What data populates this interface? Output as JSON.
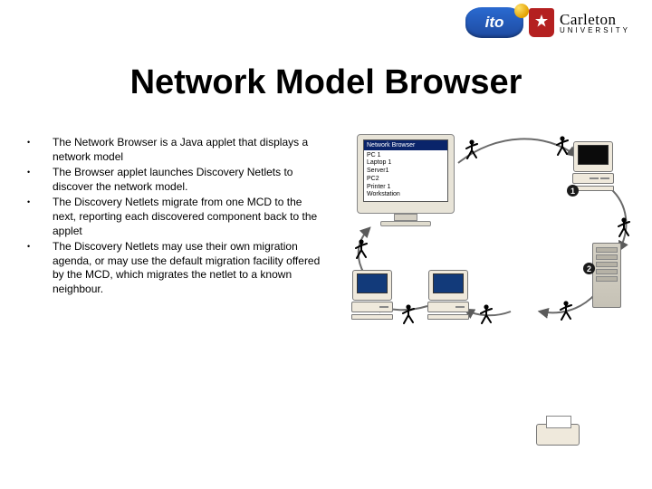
{
  "header": {
    "logo_ito_text": "ito",
    "carleton_name": "Carleton",
    "carleton_sub": "UNIVERSITY"
  },
  "title": "Network Model Browser",
  "bullets": [
    "The Network Browser is a Java applet that displays a network model",
    "The Browser applet launches Discovery Netlets to discover the network model.",
    "The Discovery Netlets migrate from one MCD to the next, reporting each discovered component back to the applet",
    "The Discovery Netlets may use their own migration agenda, or may use the default migration facility offered by the MCD, which migrates the netlet to a known neighbour."
  ],
  "diagram": {
    "browser_window_title": "Network Browser",
    "browser_list": [
      "PC 1",
      "Laptop 1",
      "Server1",
      "PC2",
      "Printer 1",
      "Workstation"
    ],
    "badges": [
      "1",
      "2"
    ],
    "nodes": [
      "browser-workstation",
      "pc-top-right",
      "pc-bottom-left",
      "pc-bottom-mid",
      "printer",
      "server"
    ]
  }
}
